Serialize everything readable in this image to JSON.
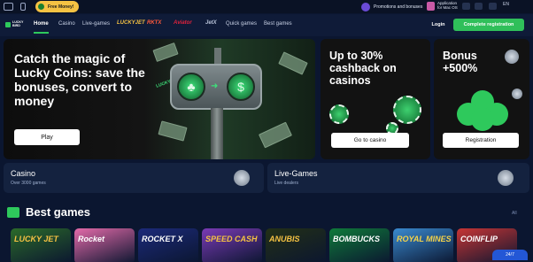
{
  "topbar": {
    "free_money": "Free Money!",
    "promotions": "Promotions and bonuses",
    "app_title": "Application",
    "app_sub": "for Mac OS",
    "language": "EN"
  },
  "nav": {
    "logo_line1": "LUCKY",
    "logo_line2": "BIRD",
    "links": [
      "Home",
      "Casino",
      "Live-games",
      "Quick games",
      "Best games"
    ],
    "brands": [
      "LUCKYJET",
      "RKTX",
      "Aviator",
      "JetX"
    ],
    "login": "Login",
    "register": "Complete registration"
  },
  "hero": {
    "title": "Catch the magic of Lucky Coins: save the bonuses, convert to money",
    "button": "Play"
  },
  "cashback": {
    "title": "Up to 30% cashback on casinos",
    "button": "Go to casino"
  },
  "bonus": {
    "title": "Bonus +500%",
    "button": "Registration"
  },
  "panels": [
    {
      "title": "Casino",
      "sub": "Over 3000 games"
    },
    {
      "title": "Live-Games",
      "sub": "Live dealers"
    }
  ],
  "best": {
    "title": "Best games",
    "all": "All"
  },
  "games": [
    {
      "label": "LUCKY JET",
      "color": "#2b6a2a"
    },
    {
      "label": "Rocket",
      "color": "#e46aa9"
    },
    {
      "label": "ROCKET X",
      "color": "#1c2a7a"
    },
    {
      "label": "SPEED CASH",
      "color": "#7a3ab5"
    },
    {
      "label": "ANUBIS",
      "color": "#233016"
    },
    {
      "label": "BOMBUCKS",
      "color": "#0f7a3a"
    },
    {
      "label": "ROYAL MINES",
      "color": "#3a8ad0"
    },
    {
      "label": "COINFLIP",
      "color": "#c73535"
    }
  ],
  "chat": "24/7",
  "colors": {
    "accent": "#2ec95c",
    "page_bg": "#0b1630"
  }
}
